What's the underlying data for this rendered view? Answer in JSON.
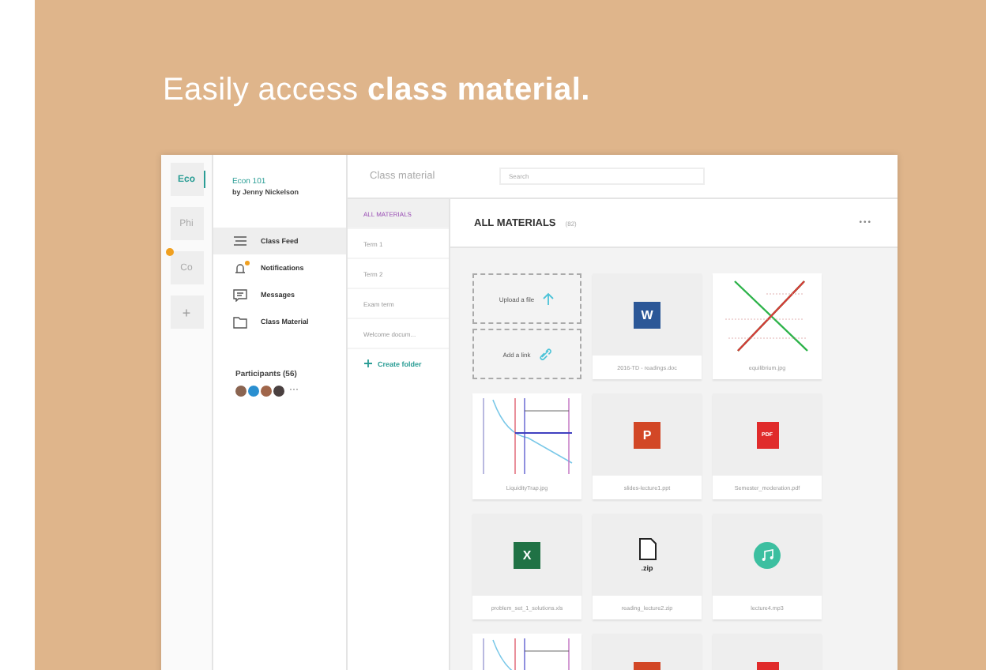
{
  "headline": "Easily access **class material.**",
  "courses": [
    {
      "label": "Eco",
      "selected": true,
      "badge": false
    },
    {
      "label": "Phi",
      "selected": false,
      "badge": false
    },
    {
      "label": "Co",
      "selected": false,
      "badge": true
    }
  ],
  "add_course": "+",
  "class_info": {
    "title": "Econ 101",
    "author": "by Jenny Nickelson"
  },
  "nav": [
    {
      "kind": "feed",
      "label": "Class Feed",
      "selected": true,
      "badge": false
    },
    {
      "kind": "bell",
      "label": "Notifications",
      "selected": false,
      "badge": true
    },
    {
      "kind": "chat",
      "label": "Messages",
      "selected": false,
      "badge": false
    },
    {
      "kind": "folder",
      "label": "Class Material",
      "selected": false,
      "badge": false
    }
  ],
  "participants": {
    "label": "Participants (56)",
    "avatars": [
      {
        "color": "#8a6450"
      },
      {
        "color": "#2a8fd0"
      },
      {
        "color": "#a0664a"
      },
      {
        "color": "#4a4040"
      }
    ],
    "more": "···"
  },
  "top_bar": {
    "title": "Class material",
    "search_placeholder": "Search"
  },
  "folders": [
    {
      "label": "ALL MATERIALS",
      "selected": true
    },
    {
      "label": "Term 1",
      "selected": false
    },
    {
      "label": "Term 2",
      "selected": false
    },
    {
      "label": "Exam term",
      "selected": false
    },
    {
      "label": "Welcome docum...",
      "selected": false
    }
  ],
  "create_folder": "Create folder",
  "main": {
    "heading": "ALL MATERIALS",
    "count": "(82)",
    "more": "•••",
    "upload": "Upload a file",
    "add_link": "Add a link"
  },
  "files": [
    {
      "kind": "word",
      "icon_text": "W",
      "name": "2016-TD - readings.doc"
    },
    {
      "kind": "cross-chart",
      "name": "equilibrium.jpg"
    },
    {
      "kind": "curve-chart",
      "name": "LiquidityTrap.jpg"
    },
    {
      "kind": "ppt",
      "icon_text": "P",
      "name": "slides-lecture1.ppt"
    },
    {
      "kind": "pdf",
      "icon_text": "PDF",
      "name": "Semester_moderation.pdf"
    },
    {
      "kind": "xls",
      "icon_text": "X",
      "name": "problem_set_1_solutions.xls"
    },
    {
      "kind": "zip",
      "icon_text": ".zip",
      "name": "reading_lecture2.zip"
    },
    {
      "kind": "audio",
      "name": "lecture4.mp3"
    },
    {
      "kind": "curve-chart"
    },
    {
      "kind": "ppt"
    },
    {
      "kind": "pdf"
    }
  ]
}
